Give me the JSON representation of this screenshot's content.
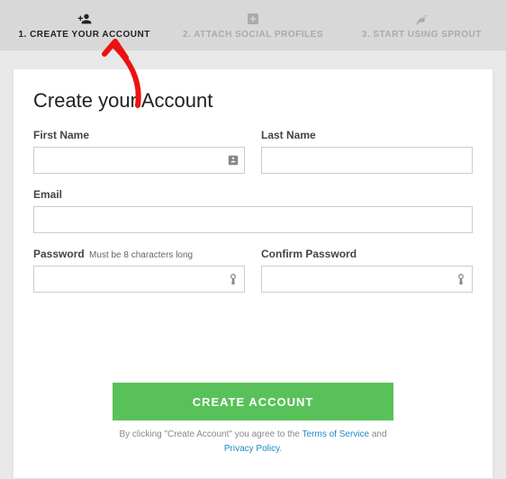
{
  "steps": {
    "s1": {
      "label": "1. CREATE YOUR ACCOUNT"
    },
    "s2": {
      "label": "2. ATTACH SOCIAL PROFILES"
    },
    "s3": {
      "label": "3. START USING SPROUT"
    }
  },
  "page": {
    "title": "Create your Account"
  },
  "form": {
    "first_name": {
      "label": "First Name",
      "value": ""
    },
    "last_name": {
      "label": "Last Name",
      "value": ""
    },
    "email": {
      "label": "Email",
      "value": ""
    },
    "password": {
      "label": "Password",
      "hint": "Must be 8 characters long",
      "value": ""
    },
    "confirm_password": {
      "label": "Confirm Password",
      "value": ""
    }
  },
  "submit": {
    "button_label": "CREATE ACCOUNT",
    "legal_prefix": "By clicking \"Create Account\" you agree to the ",
    "tos": "Terms of Service",
    "and": " and ",
    "privacy": "Privacy Policy",
    "period": "."
  }
}
